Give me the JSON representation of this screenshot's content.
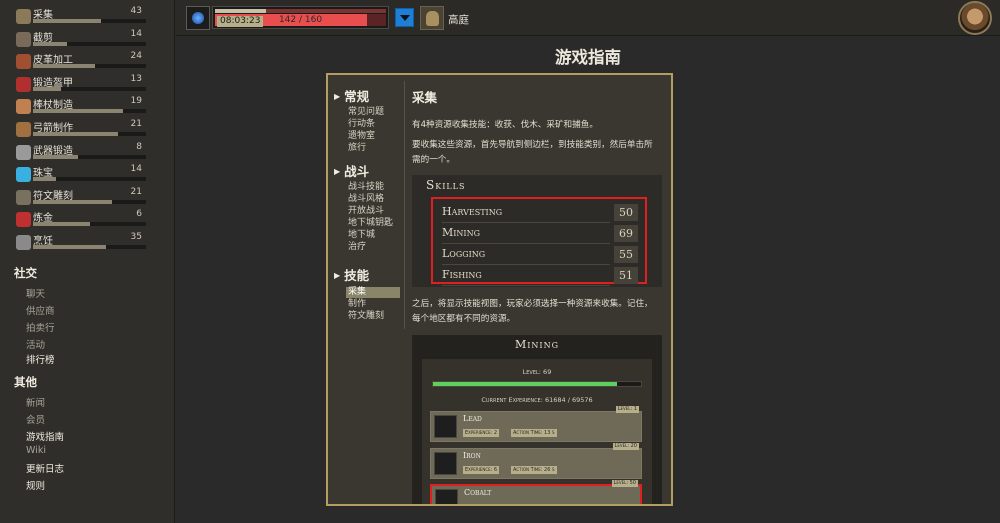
{
  "sidebar": {
    "skills": [
      {
        "name": "采集",
        "level": "43",
        "progress": 0.6,
        "icon": "harvesting-icon",
        "color": "#8a7a5a"
      },
      {
        "name": "截剪",
        "level": "14",
        "progress": 0.3,
        "icon": "trimming-icon",
        "color": "#7a6a5a"
      },
      {
        "name": "皮革加工",
        "level": "24",
        "progress": 0.55,
        "icon": "leatherworking-icon",
        "color": "#a05030"
      },
      {
        "name": "锻造盔甲",
        "level": "13",
        "progress": 0.25,
        "icon": "armorsmithing-icon",
        "color": "#b03030"
      },
      {
        "name": "棒杖制造",
        "level": "19",
        "progress": 0.8,
        "icon": "staffcrafting-icon",
        "color": "#c08050"
      },
      {
        "name": "弓箭制作",
        "level": "21",
        "progress": 0.75,
        "icon": "bowcrafting-icon",
        "color": "#a07040"
      },
      {
        "name": "武器锻造",
        "level": "8",
        "progress": 0.4,
        "icon": "weaponsmithing-icon",
        "color": "#9a9a9a"
      },
      {
        "name": "珠宝",
        "level": "14",
        "progress": 0.2,
        "icon": "jewelcrafting-icon",
        "color": "#3ab0e0"
      },
      {
        "name": "符文雕刻",
        "level": "21",
        "progress": 0.7,
        "icon": "runecarving-icon",
        "color": "#7a7060"
      },
      {
        "name": "炼金",
        "level": "6",
        "progress": 0.5,
        "icon": "alchemy-icon",
        "color": "#c03030"
      },
      {
        "name": "烹饪",
        "level": "35",
        "progress": 0.65,
        "icon": "cooking-icon",
        "color": "#8a8a8a"
      }
    ],
    "social_title": "社交",
    "social_items": [
      "聊天",
      "供应商",
      "拍卖行",
      "活动",
      "排行榜"
    ],
    "other_title": "其他",
    "other_items": [
      "新闻",
      "会员",
      "游戏指南",
      "Wiki",
      "更新日志",
      "规则"
    ]
  },
  "topbar": {
    "timer": "08:03:23",
    "hp_text": "142 / 160",
    "hp_progress": 0.8875,
    "location": "高庭",
    "colors": {
      "hp": "#e84e4e",
      "dropdown": "#1e7fd6"
    }
  },
  "main": {
    "page_title": "游戏指南",
    "toc": [
      {
        "title": "常规",
        "items": [
          "常见问题",
          "行动条",
          "遗物室",
          "旅行"
        ]
      },
      {
        "title": "战斗",
        "items": [
          "战斗技能",
          "战斗风格",
          "开放战斗",
          "地下城钥匙",
          "地下城",
          "治疗"
        ]
      },
      {
        "title": "技能",
        "items": [
          "采集",
          "制作",
          "符文雕刻"
        ]
      }
    ],
    "content_title": "采集",
    "para1": "有4种资源收集技能：收获、伐木、采矿和捕鱼。",
    "para2": "要收集这些资源，首先导航到侧边栏，到技能类别，然后单击所需的一个。",
    "para3": "之后，将显示技能视图，玩家必须选择一种资源来收集。记住，每个地区都有不同的资源。",
    "skills_image": {
      "title": "Skills",
      "rows": [
        {
          "name": "Harvesting",
          "level": "50"
        },
        {
          "name": "Mining",
          "level": "69"
        },
        {
          "name": "Logging",
          "level": "55"
        },
        {
          "name": "Fishing",
          "level": "51"
        }
      ]
    },
    "mining_image": {
      "title": "Mining",
      "level_text": "Level: 69",
      "exp_text": "Current Experience: 61684 / 69576",
      "exp_progress": 0.886,
      "resources": [
        {
          "name": "Lead",
          "exp": "Experience: 2",
          "time": "Action Time: 13 s",
          "level": "Level: 1"
        },
        {
          "name": "Iron",
          "exp": "Experience: 6",
          "time": "Action Time: 26 s",
          "level": "Level: 20"
        },
        {
          "name": "Cobalt",
          "exp": "",
          "time": "",
          "level": "Level: 50"
        }
      ]
    }
  }
}
